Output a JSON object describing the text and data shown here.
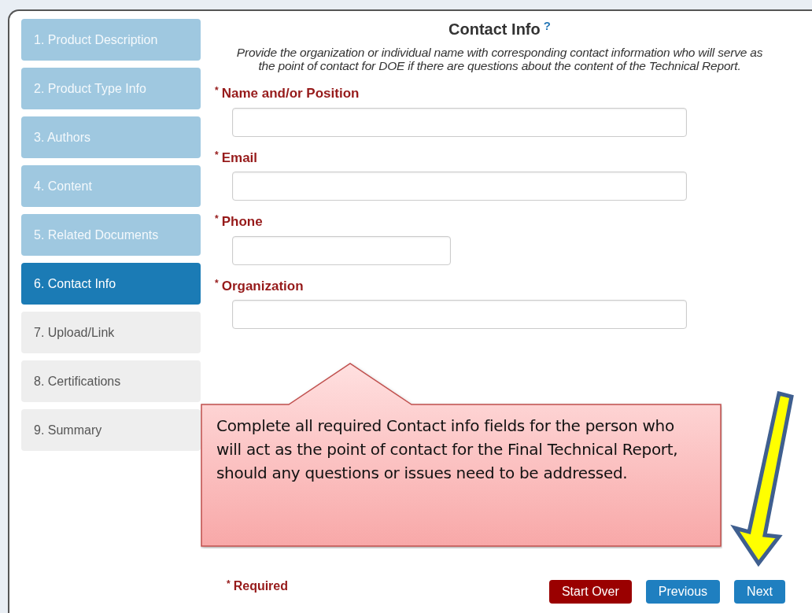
{
  "steps": [
    {
      "label": "1. Product Description",
      "completed": true,
      "selected": false
    },
    {
      "label": "2. Product Type Info",
      "completed": true,
      "selected": false
    },
    {
      "label": "3. Authors",
      "completed": true,
      "selected": false
    },
    {
      "label": "4. Content",
      "completed": true,
      "selected": false
    },
    {
      "label": "5. Related Documents",
      "completed": true,
      "selected": false
    },
    {
      "label": "6. Contact Info",
      "completed": false,
      "selected": true
    },
    {
      "label": "7. Upload/Link",
      "completed": false,
      "selected": false
    },
    {
      "label": "8. Certifications",
      "completed": false,
      "selected": false
    },
    {
      "label": "9. Summary",
      "completed": false,
      "selected": false
    }
  ],
  "heading": {
    "title": "Contact Info",
    "help": "?",
    "description": "Provide the organization or individual name with corresponding contact information who will serve as the point of contact for DOE if there are questions about the content of the Technical Report."
  },
  "fields": [
    {
      "marker": "*",
      "label": "Name and/or Position",
      "kind": "wide"
    },
    {
      "marker": "*",
      "label": "Email",
      "kind": "wide"
    },
    {
      "marker": "*",
      "label": "Phone",
      "kind": "short"
    },
    {
      "marker": "*",
      "label": "Organization",
      "kind": "wide"
    }
  ],
  "callout": {
    "text": "Complete all required Contact info fields for the person who will act as the point of contact for the Final Technical Report, should any questions or issues need to be addressed."
  },
  "footer": {
    "marker": "*",
    "note": "Required"
  },
  "buttons": [
    {
      "label": "Start Over",
      "kind": "danger"
    },
    {
      "label": "Previous",
      "kind": "primary"
    },
    {
      "label": "Next",
      "kind": "primary"
    }
  ]
}
